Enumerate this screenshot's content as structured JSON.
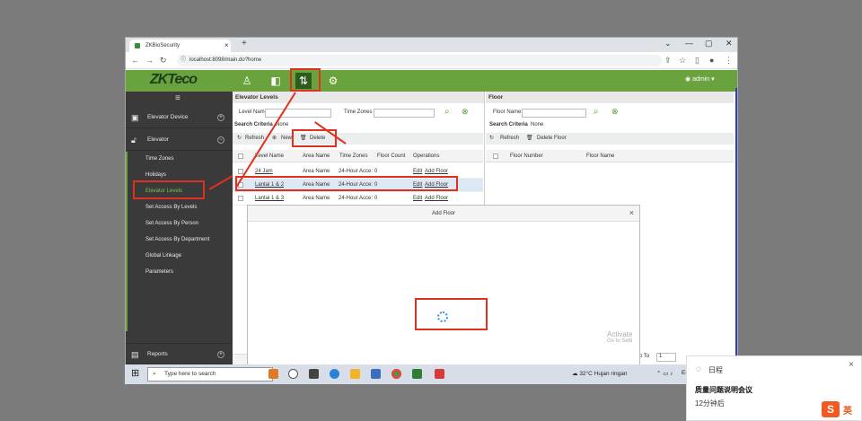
{
  "browser": {
    "tab_title": "ZKBioSecurity",
    "new_tab": "+",
    "url": "localhost:8098/main.do?home",
    "win_controls": [
      "⌄",
      "—",
      "▢",
      "✕"
    ]
  },
  "app": {
    "logo": "ZKTeco",
    "user": "admin"
  },
  "sidebar": {
    "menu_icon": "≡",
    "elevator_device": "Elevator Device",
    "elevator": "Elevator",
    "items": [
      "Time Zones",
      "Holidays",
      "Elevator Levels",
      "Set Access By Levels",
      "Set Access By Person",
      "Set Access By Department",
      "Global Linkage",
      "Parameters"
    ],
    "reports": "Reports"
  },
  "left_panel": {
    "title": "Elevator Levels",
    "level_name_label": "Level Name",
    "time_zones_label": "Time Zones",
    "search_criteria": "Search Criteria",
    "criteria_value": "None",
    "refresh": "Refresh",
    "new": "New",
    "delete": "Delete",
    "columns": [
      "Level Name",
      "Area Name",
      "Time Zones",
      "Floor Count",
      "Operations"
    ],
    "rows": [
      {
        "level": "24 Jam",
        "area": "Area Name",
        "tz": "24-Hour Acce:",
        "count": "0",
        "edit": "Edit",
        "add": "Add Floor"
      },
      {
        "level": "Lantai 1 & 2",
        "area": "Area Name",
        "tz": "24-Hour Acce:",
        "count": "0",
        "edit": "Edit",
        "add": "Add Floor"
      },
      {
        "level": "Lantai 1 & 3",
        "area": "Area Name",
        "tz": "24-Hour Acce:",
        "count": "0",
        "edit": "Edit",
        "add": "Add Floor"
      }
    ]
  },
  "right_panel": {
    "title": "Floor",
    "floor_name_label": "Floor Name",
    "search_criteria": "Search Criteria",
    "criteria_value": "None",
    "refresh": "Refresh",
    "delete_floor": "Delete Floor",
    "columns": [
      "Floor Number",
      "Floor Name"
    ],
    "jump_to": "mp To",
    "page": "1"
  },
  "modal": {
    "title": "Add Floor",
    "close": "×"
  },
  "watermark": {
    "line1": "Activate",
    "line2": "Go to Setti"
  },
  "taskbar": {
    "search": "Type here to search",
    "weather": "32°C  Hujan ringan",
    "ime": "ENG"
  },
  "notification": {
    "app": "日程",
    "title": "质量问题说明会议",
    "time": "12分钟后",
    "close": "×",
    "ime_badge": "英"
  },
  "colors": {
    "accent": "#6aa33e",
    "highlight": "#e03020"
  }
}
